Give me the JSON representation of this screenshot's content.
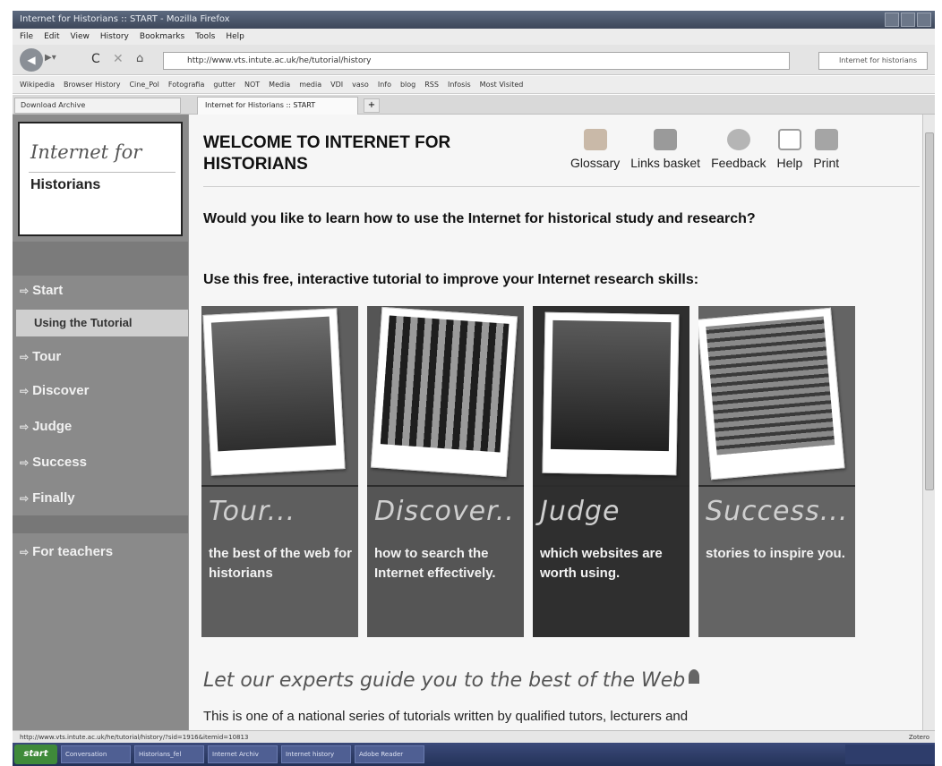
{
  "browser": {
    "title": "Internet for Historians :: START - Mozilla Firefox",
    "menu": [
      "File",
      "Edit",
      "View",
      "History",
      "Bookmarks",
      "Tools",
      "Help"
    ],
    "url": "http://www.vts.intute.ac.uk/he/tutorial/history",
    "search_placeholder": "Internet for historians",
    "bookmarks": [
      "Wikipedia",
      "Browser History",
      "Cine_Pol",
      "Fotografia",
      "gutter",
      "NOT",
      "Media",
      "media",
      "VDI",
      "vaso",
      "Info",
      "blog",
      "RSS",
      "Infosis",
      "Most Visited"
    ],
    "sidebar_tab": "Download Archive",
    "page_tab": "Internet for Historians :: START",
    "status_url": "http://www.vts.intute.ac.uk/he/tutorial/history/?sid=1916&itemid=10813",
    "status_done": "Zotero",
    "taskbar_start": "start",
    "taskbar_items": [
      "Conversation",
      "Historians_fel",
      "Internet Archiv",
      "Internet history",
      "Adobe Reader"
    ],
    "tray_time": ""
  },
  "sidebar": {
    "logo_line1": "Internet for",
    "logo_line2": "Historians",
    "items": [
      {
        "label": "Start"
      },
      {
        "label": "Using the Tutorial"
      },
      {
        "label": "Tour"
      },
      {
        "label": "Discover"
      },
      {
        "label": "Judge"
      },
      {
        "label": "Success"
      },
      {
        "label": "Finally"
      },
      {
        "label": "For teachers"
      }
    ]
  },
  "header": {
    "title": "WELCOME TO INTERNET FOR HISTORIANS",
    "tools": [
      {
        "label": "Glossary",
        "icon": "glossary-icon",
        "color": "#c9b9a8"
      },
      {
        "label": "Links basket",
        "icon": "basket-icon",
        "color": "#9a9a9a"
      },
      {
        "label": "Feedback",
        "icon": "feedback-icon",
        "color": "#b5b5b5"
      },
      {
        "label": "Help",
        "icon": "help-icon",
        "color": "#9c9c9c"
      },
      {
        "label": "Print",
        "icon": "print-icon",
        "color": "#a5a5a5"
      }
    ]
  },
  "main": {
    "question": "Would you like to learn how to use the Internet for historical study and research?",
    "intro_line": "Use this free, interactive tutorial to improve your Internet research skills:",
    "cards": [
      {
        "word": "Tour...",
        "desc": "the best of the web for historians"
      },
      {
        "word": "Discover..",
        "desc": "how to search the Internet effectively."
      },
      {
        "word": "Judge",
        "desc": "which websites are worth using."
      },
      {
        "word": "Success...",
        "desc": "stories to inspire you."
      }
    ],
    "experts_heading": "Let our experts guide you to the best of the Web",
    "body_text": "This is one of a national series of tutorials written by qualified tutors, lecturers and"
  }
}
